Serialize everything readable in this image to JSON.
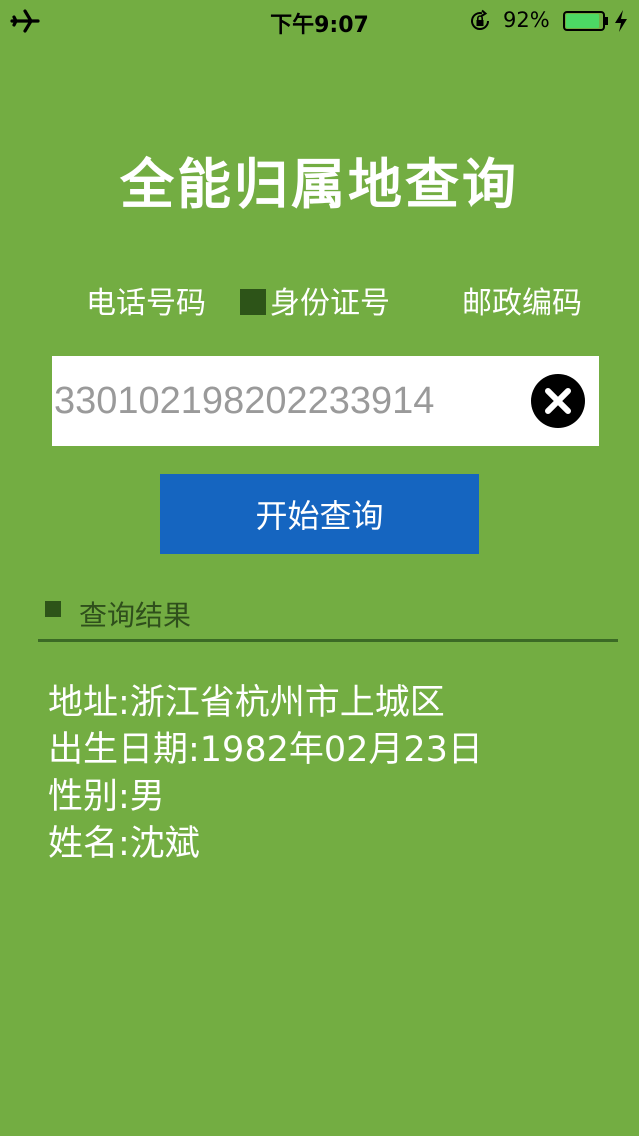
{
  "status_bar": {
    "time": "下午9:07",
    "battery_percent": "92%",
    "battery_level": 0.92,
    "icons": [
      "airplane-icon",
      "rotation-lock-icon",
      "battery-icon",
      "charging-bolt-icon"
    ]
  },
  "app": {
    "title": "全能归属地查询"
  },
  "tabs": [
    {
      "label": "电话号码",
      "selected": false
    },
    {
      "label": "身份证号",
      "selected": true
    },
    {
      "label": "邮政编码",
      "selected": false
    }
  ],
  "search": {
    "value": "330102198202233914",
    "clear_icon": "close-circle-icon"
  },
  "actions": {
    "query_label": "开始查询"
  },
  "results": {
    "header": "查询结果",
    "lines": [
      "地址:浙江省杭州市上城区",
      "出生日期:1982年02月23日",
      "性别:男",
      "姓名:沈斌"
    ]
  },
  "colors": {
    "background": "#73ad42",
    "button": "#1565c0",
    "marker": "#2d5418",
    "input_text": "#9a9a9a"
  }
}
